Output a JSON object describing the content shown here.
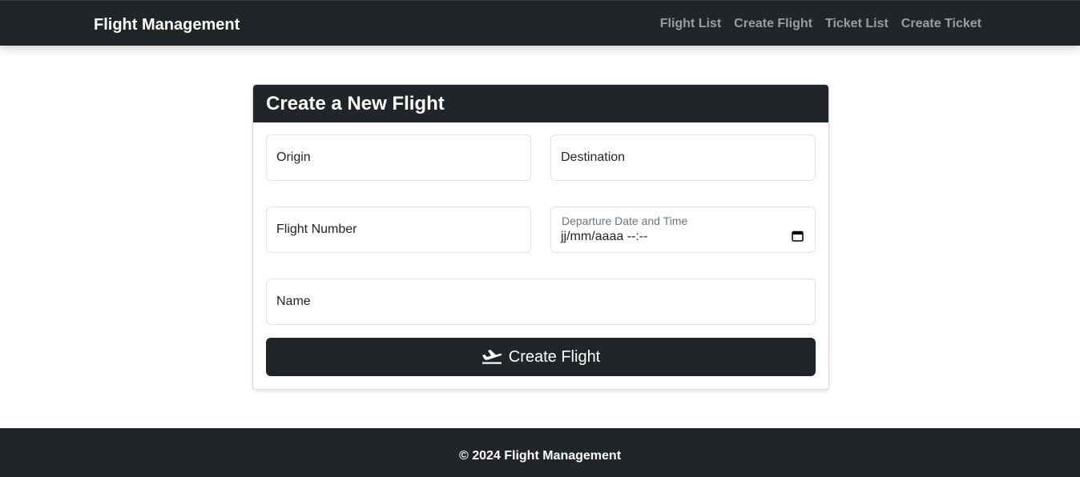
{
  "navbar": {
    "brand": "Flight Management",
    "links": [
      "Flight List",
      "Create Flight",
      "Ticket List",
      "Create Ticket"
    ]
  },
  "form": {
    "title": "Create a New Flight",
    "origin_placeholder": "Origin",
    "destination_placeholder": "Destination",
    "flight_number_placeholder": "Flight Number",
    "departure_label": "Departure Date and Time",
    "departure_value": "jj/mm/aaaa --:--",
    "name_placeholder": "Name",
    "submit_label": "Create Flight"
  },
  "footer": {
    "text": "© 2024 Flight Management"
  },
  "colors": {
    "dark": "#212529",
    "muted_link": "rgba(255,255,255,0.55)"
  },
  "icons": {
    "submit": "plane-departure-icon",
    "date": "calendar-icon"
  }
}
